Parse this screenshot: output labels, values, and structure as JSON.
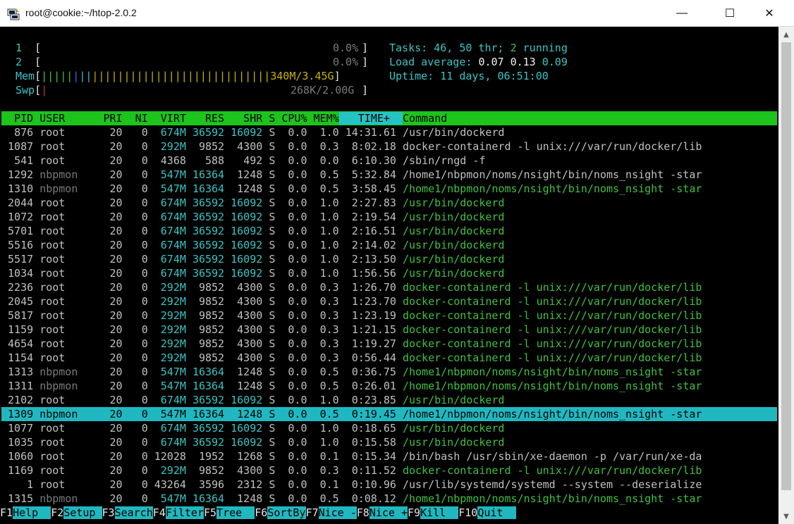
{
  "window": {
    "title": "root@cookie:~/htop-2.0.2",
    "minimize": "—",
    "maximize": "☐",
    "close": "✕"
  },
  "meters": {
    "cpu1": {
      "label": "1",
      "open": "[",
      "value": "0.0%",
      "close": "]"
    },
    "cpu2": {
      "label": "2",
      "open": "[",
      "value": "0.0%",
      "close": "]"
    },
    "mem": {
      "label": "Mem",
      "open": "[",
      "bars_green": "|||||",
      "bars_blue": "|",
      "bars_cyan": "||",
      "bars_yellow": "||||||||||||||||||||||||||||",
      "value": "340M/3.45G",
      "close": "]"
    },
    "swp": {
      "label": "Swp",
      "open": "[",
      "bar_red": "|",
      "value": "268K/2.00G",
      "close": "]"
    }
  },
  "summary": {
    "tasks_label": "Tasks: ",
    "tasks": "46",
    "thr_sep": ", ",
    "thr": "50",
    "thr_label": " thr; ",
    "running": "2",
    "running_label": " running",
    "load_label": "Load average: ",
    "load1": "0.07",
    "load5": "0.13",
    "load15": "0.09",
    "uptime_label": "Uptime: ",
    "uptime": "11 days, 06:51:00"
  },
  "header": {
    "cols": [
      "  PID",
      " USER     ",
      " PRI",
      "  NI",
      "  VIRT",
      "   RES",
      "   SHR",
      " S",
      " CPU%",
      " MEM%"
    ],
    "sort_col": "   TIME+  ",
    "command": "Command"
  },
  "processes": [
    {
      "pid": "876",
      "user": "root",
      "pri": "20",
      "ni": "0",
      "virt": "674M",
      "res": "36592",
      "shr": "16092",
      "s": "S",
      "cpu": "0.0",
      "mem": "1.0",
      "time": "14:31.61",
      "cmd": "/usr/bin/dockerd",
      "thread": false,
      "selected": false
    },
    {
      "pid": "1087",
      "user": "root",
      "pri": "20",
      "ni": "0",
      "virt": "292M",
      "res": "9852",
      "shr": "4300",
      "s": "S",
      "cpu": "0.0",
      "mem": "0.3",
      "time": "8:02.18",
      "cmd": "docker-containerd -l unix:///var/run/docker/lib",
      "thread": false,
      "selected": false
    },
    {
      "pid": "541",
      "user": "root",
      "pri": "20",
      "ni": "0",
      "virt": "4368",
      "res": "588",
      "shr": "492",
      "s": "S",
      "cpu": "0.0",
      "mem": "0.0",
      "time": "6:10.30",
      "cmd": "/sbin/rngd -f",
      "thread": false,
      "selected": false
    },
    {
      "pid": "1292",
      "user": "nbpmon",
      "pri": "20",
      "ni": "0",
      "virt": "547M",
      "res": "16364",
      "shr": "1248",
      "s": "S",
      "cpu": "0.0",
      "mem": "0.5",
      "time": "5:32.84",
      "cmd": "/home1/nbpmon/noms/nsight/bin/noms_nsight -star",
      "thread": false,
      "selected": false
    },
    {
      "pid": "1310",
      "user": "nbpmon",
      "pri": "20",
      "ni": "0",
      "virt": "547M",
      "res": "16364",
      "shr": "1248",
      "s": "S",
      "cpu": "0.0",
      "mem": "0.5",
      "time": "3:58.45",
      "cmd": "/home1/nbpmon/noms/nsight/bin/noms_nsight -star",
      "thread": true,
      "selected": false
    },
    {
      "pid": "2044",
      "user": "root",
      "pri": "20",
      "ni": "0",
      "virt": "674M",
      "res": "36592",
      "shr": "16092",
      "s": "S",
      "cpu": "0.0",
      "mem": "1.0",
      "time": "2:27.83",
      "cmd": "/usr/bin/dockerd",
      "thread": true,
      "selected": false
    },
    {
      "pid": "1072",
      "user": "root",
      "pri": "20",
      "ni": "0",
      "virt": "674M",
      "res": "36592",
      "shr": "16092",
      "s": "S",
      "cpu": "0.0",
      "mem": "1.0",
      "time": "2:19.54",
      "cmd": "/usr/bin/dockerd",
      "thread": true,
      "selected": false
    },
    {
      "pid": "5701",
      "user": "root",
      "pri": "20",
      "ni": "0",
      "virt": "674M",
      "res": "36592",
      "shr": "16092",
      "s": "S",
      "cpu": "0.0",
      "mem": "1.0",
      "time": "2:16.51",
      "cmd": "/usr/bin/dockerd",
      "thread": true,
      "selected": false
    },
    {
      "pid": "5516",
      "user": "root",
      "pri": "20",
      "ni": "0",
      "virt": "674M",
      "res": "36592",
      "shr": "16092",
      "s": "S",
      "cpu": "0.0",
      "mem": "1.0",
      "time": "2:14.02",
      "cmd": "/usr/bin/dockerd",
      "thread": true,
      "selected": false
    },
    {
      "pid": "5517",
      "user": "root",
      "pri": "20",
      "ni": "0",
      "virt": "674M",
      "res": "36592",
      "shr": "16092",
      "s": "S",
      "cpu": "0.0",
      "mem": "1.0",
      "time": "2:13.50",
      "cmd": "/usr/bin/dockerd",
      "thread": true,
      "selected": false
    },
    {
      "pid": "1034",
      "user": "root",
      "pri": "20",
      "ni": "0",
      "virt": "674M",
      "res": "36592",
      "shr": "16092",
      "s": "S",
      "cpu": "0.0",
      "mem": "1.0",
      "time": "1:56.56",
      "cmd": "/usr/bin/dockerd",
      "thread": true,
      "selected": false
    },
    {
      "pid": "2236",
      "user": "root",
      "pri": "20",
      "ni": "0",
      "virt": "292M",
      "res": "9852",
      "shr": "4300",
      "s": "S",
      "cpu": "0.0",
      "mem": "0.3",
      "time": "1:26.70",
      "cmd": "docker-containerd -l unix:///var/run/docker/lib",
      "thread": true,
      "selected": false
    },
    {
      "pid": "2045",
      "user": "root",
      "pri": "20",
      "ni": "0",
      "virt": "292M",
      "res": "9852",
      "shr": "4300",
      "s": "S",
      "cpu": "0.0",
      "mem": "0.3",
      "time": "1:23.70",
      "cmd": "docker-containerd -l unix:///var/run/docker/lib",
      "thread": true,
      "selected": false
    },
    {
      "pid": "5817",
      "user": "root",
      "pri": "20",
      "ni": "0",
      "virt": "292M",
      "res": "9852",
      "shr": "4300",
      "s": "S",
      "cpu": "0.0",
      "mem": "0.3",
      "time": "1:23.19",
      "cmd": "docker-containerd -l unix:///var/run/docker/lib",
      "thread": true,
      "selected": false
    },
    {
      "pid": "1159",
      "user": "root",
      "pri": "20",
      "ni": "0",
      "virt": "292M",
      "res": "9852",
      "shr": "4300",
      "s": "S",
      "cpu": "0.0",
      "mem": "0.3",
      "time": "1:21.15",
      "cmd": "docker-containerd -l unix:///var/run/docker/lib",
      "thread": true,
      "selected": false
    },
    {
      "pid": "4654",
      "user": "root",
      "pri": "20",
      "ni": "0",
      "virt": "292M",
      "res": "9852",
      "shr": "4300",
      "s": "S",
      "cpu": "0.0",
      "mem": "0.3",
      "time": "1:19.27",
      "cmd": "docker-containerd -l unix:///var/run/docker/lib",
      "thread": true,
      "selected": false
    },
    {
      "pid": "1154",
      "user": "root",
      "pri": "20",
      "ni": "0",
      "virt": "292M",
      "res": "9852",
      "shr": "4300",
      "s": "S",
      "cpu": "0.0",
      "mem": "0.3",
      "time": "0:56.44",
      "cmd": "docker-containerd -l unix:///var/run/docker/lib",
      "thread": true,
      "selected": false
    },
    {
      "pid": "1313",
      "user": "nbpmon",
      "pri": "20",
      "ni": "0",
      "virt": "547M",
      "res": "16364",
      "shr": "1248",
      "s": "S",
      "cpu": "0.0",
      "mem": "0.5",
      "time": "0:36.75",
      "cmd": "/home1/nbpmon/noms/nsight/bin/noms_nsight -star",
      "thread": true,
      "selected": false
    },
    {
      "pid": "1311",
      "user": "nbpmon",
      "pri": "20",
      "ni": "0",
      "virt": "547M",
      "res": "16364",
      "shr": "1248",
      "s": "S",
      "cpu": "0.0",
      "mem": "0.5",
      "time": "0:26.01",
      "cmd": "/home1/nbpmon/noms/nsight/bin/noms_nsight -star",
      "thread": true,
      "selected": false
    },
    {
      "pid": "2102",
      "user": "root",
      "pri": "20",
      "ni": "0",
      "virt": "674M",
      "res": "36592",
      "shr": "16092",
      "s": "S",
      "cpu": "0.0",
      "mem": "1.0",
      "time": "0:23.85",
      "cmd": "/usr/bin/dockerd",
      "thread": true,
      "selected": false
    },
    {
      "pid": "1309",
      "user": "nbpmon",
      "pri": "20",
      "ni": "0",
      "virt": "547M",
      "res": "16364",
      "shr": "1248",
      "s": "S",
      "cpu": "0.0",
      "mem": "0.5",
      "time": "0:19.45",
      "cmd": "/home1/nbpmon/noms/nsight/bin/noms_nsight -star",
      "thread": true,
      "selected": true
    },
    {
      "pid": "1077",
      "user": "root",
      "pri": "20",
      "ni": "0",
      "virt": "674M",
      "res": "36592",
      "shr": "16092",
      "s": "S",
      "cpu": "0.0",
      "mem": "1.0",
      "time": "0:18.65",
      "cmd": "/usr/bin/dockerd",
      "thread": true,
      "selected": false
    },
    {
      "pid": "1035",
      "user": "root",
      "pri": "20",
      "ni": "0",
      "virt": "674M",
      "res": "36592",
      "shr": "16092",
      "s": "S",
      "cpu": "0.0",
      "mem": "1.0",
      "time": "0:15.58",
      "cmd": "/usr/bin/dockerd",
      "thread": true,
      "selected": false
    },
    {
      "pid": "1060",
      "user": "root",
      "pri": "20",
      "ni": "0",
      "virt": "12028",
      "res": "1952",
      "shr": "1268",
      "s": "S",
      "cpu": "0.0",
      "mem": "0.1",
      "time": "0:15.34",
      "cmd": "/bin/bash /usr/sbin/xe-daemon -p /var/run/xe-da",
      "thread": false,
      "selected": false
    },
    {
      "pid": "1169",
      "user": "root",
      "pri": "20",
      "ni": "0",
      "virt": "292M",
      "res": "9852",
      "shr": "4300",
      "s": "S",
      "cpu": "0.0",
      "mem": "0.3",
      "time": "0:11.52",
      "cmd": "docker-containerd -l unix:///var/run/docker/lib",
      "thread": true,
      "selected": false
    },
    {
      "pid": "1",
      "user": "root",
      "pri": "20",
      "ni": "0",
      "virt": "43264",
      "res": "3596",
      "shr": "2312",
      "s": "S",
      "cpu": "0.0",
      "mem": "0.1",
      "time": "0:10.96",
      "cmd": "/usr/lib/systemd/systemd --system --deserialize",
      "thread": false,
      "selected": false
    },
    {
      "pid": "1315",
      "user": "nbpmon",
      "pri": "20",
      "ni": "0",
      "virt": "547M",
      "res": "16364",
      "shr": "1248",
      "s": "S",
      "cpu": "0.0",
      "mem": "0.5",
      "time": "0:08.12",
      "cmd": "/home1/nbpmon/noms/nsight/bin/noms_nsight -star",
      "thread": true,
      "selected": false
    }
  ],
  "fkeys": [
    {
      "key": "F1",
      "label": "Help  "
    },
    {
      "key": "F2",
      "label": "Setup "
    },
    {
      "key": "F3",
      "label": "Search"
    },
    {
      "key": "F4",
      "label": "Filter"
    },
    {
      "key": "F5",
      "label": "Tree  "
    },
    {
      "key": "F6",
      "label": "SortBy"
    },
    {
      "key": "F7",
      "label": "Nice -"
    },
    {
      "key": "F8",
      "label": "Nice +"
    },
    {
      "key": "F9",
      "label": "Kill  "
    },
    {
      "key": "F10",
      "label": "Quit  "
    }
  ],
  "colors": {
    "header_green": "#1cc41c",
    "select_cyan": "#20b8c0",
    "cyan_text": "#3ac4c4",
    "thread_green": "#40c040"
  }
}
